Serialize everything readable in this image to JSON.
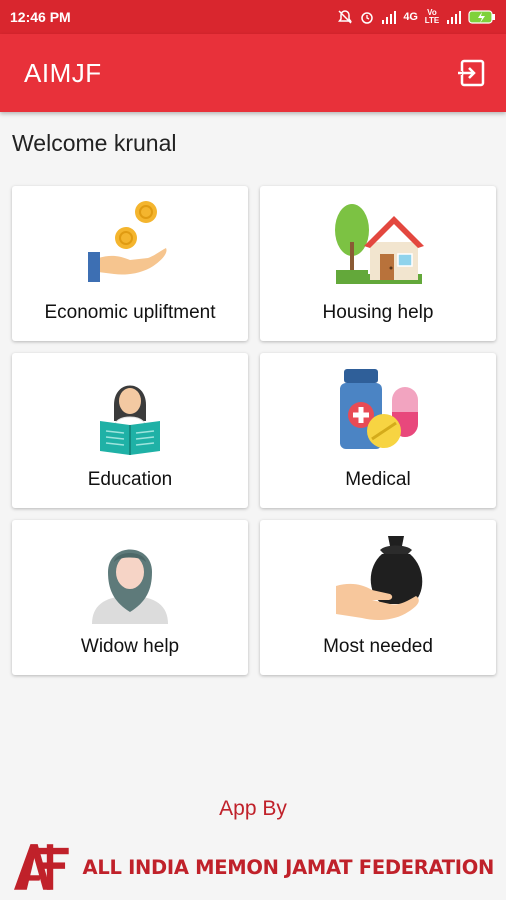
{
  "status_bar": {
    "time": "12:46 PM",
    "network": "4G",
    "volte": "Vo LTE"
  },
  "app_bar": {
    "title": "AIMJF"
  },
  "welcome": {
    "text": "Welcome krunal"
  },
  "cards": [
    {
      "label": "Economic upliftment",
      "icon": "coins-hand-icon"
    },
    {
      "label": "Housing help",
      "icon": "house-icon"
    },
    {
      "label": "Education",
      "icon": "reading-student-icon"
    },
    {
      "label": "Medical",
      "icon": "medicine-icon"
    },
    {
      "label": "Widow help",
      "icon": "widow-icon"
    },
    {
      "label": "Most needed",
      "icon": "money-bag-hand-icon"
    }
  ],
  "footer": {
    "app_by": "App By",
    "org_name": "ALL INDIA MEMON JAMAT FEDERATION"
  },
  "colors": {
    "primary": "#e8313a",
    "status_bar": "#d9262e",
    "footer_text": "#c0212a"
  }
}
